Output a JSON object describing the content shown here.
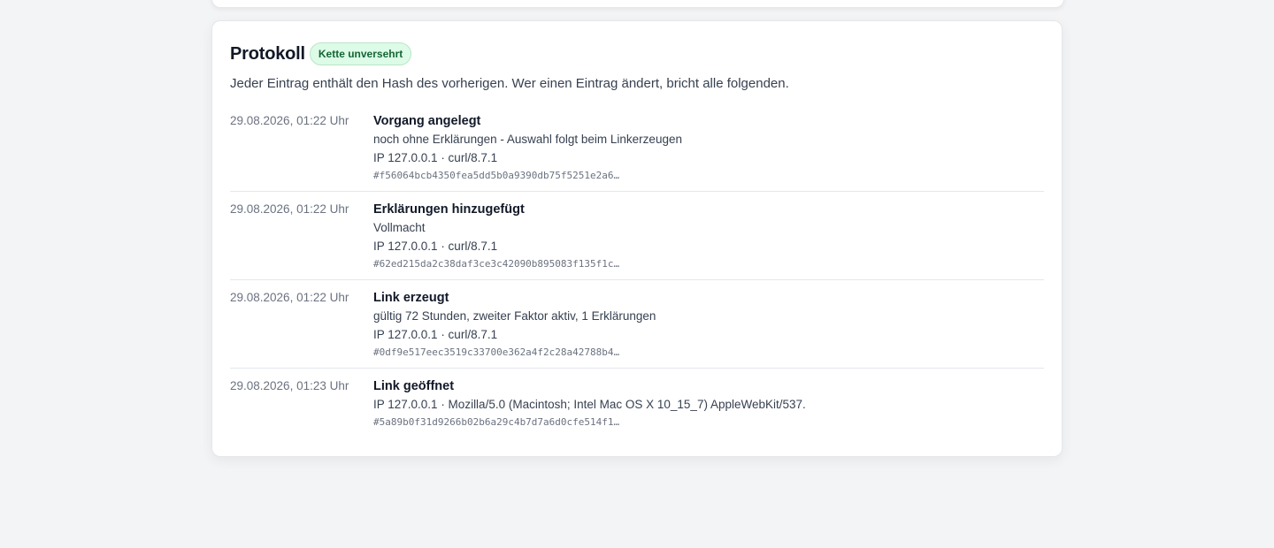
{
  "protocol": {
    "title": "Protokoll",
    "badge": "Kette unversehrt",
    "description": "Jeder Eintrag enthält den Hash des vorherigen. Wer einen Eintrag ändert, bricht alle folgenden.",
    "entries": [
      {
        "time": "29.08.2026, 01:22 Uhr",
        "action": "Vorgang angelegt",
        "detail": "noch ohne Erklärungen - Auswahl folgt beim Linkerzeugen",
        "meta": "IP 127.0.0.1 · curl/8.7.1",
        "hash": "#f56064bcb4350fea5dd5b0a9390db75f5251e2a6…"
      },
      {
        "time": "29.08.2026, 01:22 Uhr",
        "action": "Erklärungen hinzugefügt",
        "detail": "Vollmacht",
        "meta": "IP 127.0.0.1 · curl/8.7.1",
        "hash": "#62ed215da2c38daf3ce3c42090b895083f135f1c…"
      },
      {
        "time": "29.08.2026, 01:22 Uhr",
        "action": "Link erzeugt",
        "detail": "gültig 72 Stunden, zweiter Faktor aktiv, 1 Erklärungen",
        "meta": "IP 127.0.0.1 · curl/8.7.1",
        "hash": "#0df9e517eec3519c33700e362a4f2c28a42788b4…"
      },
      {
        "time": "29.08.2026, 01:23 Uhr",
        "action": "Link geöffnet",
        "meta": "IP 127.0.0.1 · Mozilla/5.0 (Macintosh; Intel Mac OS X 10_15_7) AppleWebKit/537.",
        "hash": "#5a89b0f31d9266b02b6a29c4b7d7a6d0cfe514f1…"
      }
    ]
  },
  "colors": {
    "badge_text": "#166534",
    "badge_bg": "#dcfce7",
    "page_bg": "#f3f4f6"
  }
}
